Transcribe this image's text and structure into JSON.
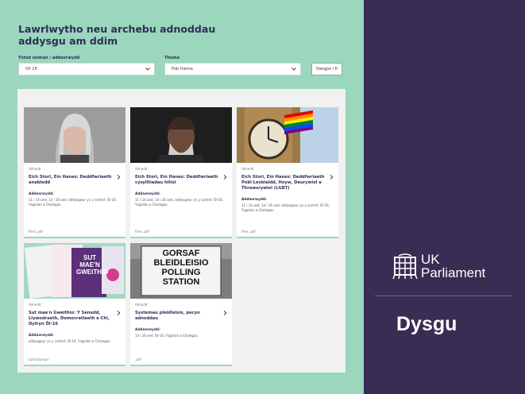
{
  "page": {
    "title": "Lawrlwytho neu archebu adnoddau addysgu am ddim"
  },
  "filters": {
    "year_label": "Ystod oedran / addasrwydd",
    "year_value": "Oll 16",
    "theme_label": "Thema",
    "theme_value": "Pob thema",
    "apply_label": "Dangos i fi"
  },
  "cards": [
    {
      "tag": "Adnodd",
      "title": "Eich Stori, Ein Hanes: Deddfwriaeth anabledd",
      "sublabel": "Addasrwydd:",
      "meta": "11 i 14 oed, 14 i 16 oed, addysgwyr yn y cartref, Ôl-16, Ysgolion a Cholegau",
      "filetype": "Files  .pdf"
    },
    {
      "tag": "Adnodd",
      "title": "Eich Stori, Ein Hanes: Deddfwriaeth cysylltiadau hiliol",
      "sublabel": "Addasrwydd:",
      "meta": "11 i 14 oed, 14 i 16 oed, addysgwyr yn y cartref, Ôl-16, Ysgolion a Cholegau",
      "filetype": "Files  .pdf"
    },
    {
      "tag": "Adnodd",
      "title": "Eich Stori, Ein Hanes: Deddfwriaeth Pobl Lesbiaidd, Hoyw, Deurywiol a Thrawsrywiol (LGBT)",
      "sublabel": "Addasrwydd:",
      "meta": "11 i 14 oed, 14 i 16 oed, addysgwyr yn y cartref, Ôl-16, Ysgolion a Cholegau",
      "filetype": "Files  .pdf"
    },
    {
      "tag": "Adnodd",
      "title": "Sut mae'n Gweithio: Y Senedd, Llywodraeth, Democratiaeth a Chi, Dyfryn Ôl-16",
      "sublabel": "Addasrwydd:",
      "meta": "addysgwyr yn y cartref, Ôl-16, Ysgolion a Cholegau",
      "filetype": "Lyfryn/pecyn"
    },
    {
      "tag": "Adnodd",
      "title": "Systemau pleidleisio, pecyn adnoddau",
      "sublabel": "Addasrwydd:",
      "meta": "14 i 16 oed, Ôl-16, Ysgolion a Cholegau",
      "filetype": ".pdf"
    }
  ],
  "card_images": {
    "booklet_text": "SUT MAE'N GWEITHIO",
    "sign_line1": "GORSAF",
    "sign_line2": "BLEIDLEISIO",
    "sign_line3": "POLLING",
    "sign_line4": "STATION"
  },
  "brand": {
    "logo_line1": "UK",
    "logo_line2": "Parliament",
    "section": "Dysgu"
  },
  "colors": {
    "mint": "#9ad7bd",
    "navy_purple": "#392d53",
    "title_navy": "#2e2f55"
  }
}
